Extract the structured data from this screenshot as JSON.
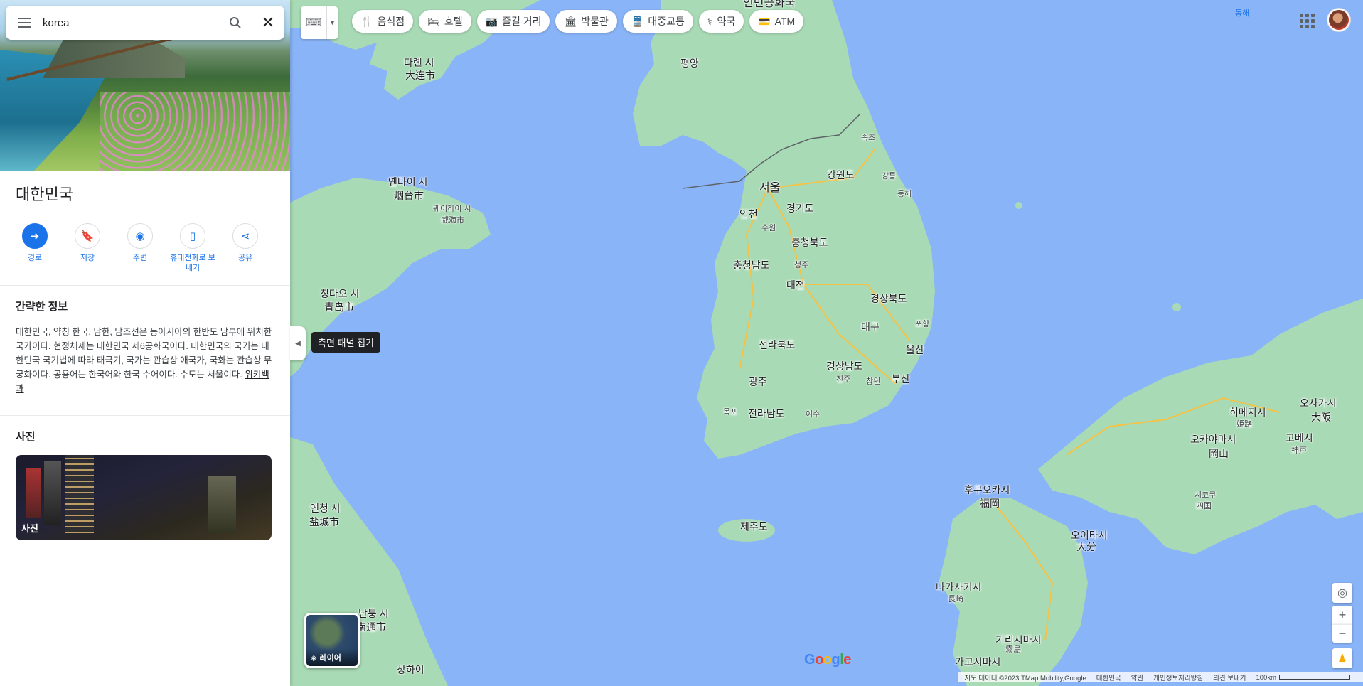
{
  "search": {
    "value": "korea"
  },
  "place": {
    "title": "대한민국",
    "actions": [
      {
        "label": "경로"
      },
      {
        "label": "저장"
      },
      {
        "label": "주변"
      },
      {
        "label": "휴대전화로 보내기"
      },
      {
        "label": "공유"
      }
    ]
  },
  "overview": {
    "heading": "간략한 정보",
    "text": "대한민국, 약칭 한국, 남한, 남조선은 동아시아의 한반도 남부에 위치한 국가이다. 현정체제는 대한민국 제6공화국이다. 대한민국의 국기는 대한민국 국기법에 따라 태극기, 국가는 관습상 애국가, 국화는 관습상 무궁화이다. 공용어는 한국어와 한국 수어이다. 수도는 서울이다.",
    "source_link": "위키백과"
  },
  "photos": {
    "heading": "사진",
    "caption": "사진"
  },
  "panel": {
    "collapse_tooltip": "측면 패널 접기"
  },
  "chips": [
    {
      "label": "음식점",
      "icon": "restaurant-icon"
    },
    {
      "label": "호텔",
      "icon": "hotel-icon"
    },
    {
      "label": "즐길 거리",
      "icon": "camera-icon"
    },
    {
      "label": "박물관",
      "icon": "museum-icon"
    },
    {
      "label": "대중교통",
      "icon": "transit-icon"
    },
    {
      "label": "약국",
      "icon": "pharmacy-icon"
    },
    {
      "label": "ATM",
      "icon": "atm-icon"
    }
  ],
  "layers": {
    "label": "레이어"
  },
  "map_labels": {
    "north_korea": "인민공화국",
    "pyongyang": "평양",
    "seoul": "서울",
    "incheon": "인천",
    "suwon": "수원",
    "gangwon": "강원도",
    "gyeonggi": "경기도",
    "sokcho": "속초",
    "gangneung": "강릉",
    "donghae": "동해",
    "chungbuk": "충청북도",
    "chungnam": "충청남도",
    "cheongju": "청주",
    "daejeon": "대전",
    "gyeongbuk": "경상북도",
    "daegu": "대구",
    "pohang": "포항",
    "jeonbuk": "전라북도",
    "ulsan": "울산",
    "gyeongnam": "경상남도",
    "jinju": "진주",
    "changwon": "창원",
    "busan": "부산",
    "gwangju": "광주",
    "mokpo": "목포",
    "jeonnam": "전라남도",
    "yeosu": "여수",
    "jeju": "제주도",
    "dalian_ko": "다롄 시",
    "dalian_zh": "大连市",
    "yantai_ko": "옌타이 시",
    "yantai_zh": "烟台市",
    "weihai_ko": "웨이하이 시",
    "weihai_zh": "威海市",
    "qingdao_ko": "칭다오 시",
    "qingdao_zh": "青岛市",
    "yancheng_ko": "옌청 시",
    "yancheng_zh": "盐城市",
    "nantong_ko": "난퉁 시",
    "nantong_zh": "南通市",
    "shanghai_ko": "상하이",
    "fukuoka_ko": "후쿠오카시",
    "fukuoka_ja": "福岡",
    "nagasaki_ko": "나가사키시",
    "nagasaki_ja": "長崎",
    "oita_ko": "오이타시",
    "oita_ja": "大分",
    "kagoshima_ko": "가고시마시",
    "kirishima_ko": "기리시마시",
    "kirishima_ja": "霧島",
    "okayama_ko": "오카야마시",
    "okayama_ja": "岡山",
    "himeji_ko": "히메지시",
    "himeji_ja": "姫路",
    "osaka_ko": "오사카시",
    "osaka_ja": "大阪",
    "kobe_ko": "고베시",
    "kobe_ja": "神戸",
    "shikoku_ko": "시코쿠",
    "shikoku_ja": "四国",
    "east_sea": "동해"
  },
  "footer": {
    "attribution": "지도 데이터 ©2023 TMap Mobility,Google",
    "country": "대한민국",
    "terms": "약관",
    "privacy": "개인정보처리방침",
    "feedback": "의견 보내기",
    "scale": "100km"
  },
  "google_logo": "Google",
  "colors": {
    "sea": "#8ab4f8",
    "land": "#a8dab5",
    "accent": "#1a73e8"
  }
}
